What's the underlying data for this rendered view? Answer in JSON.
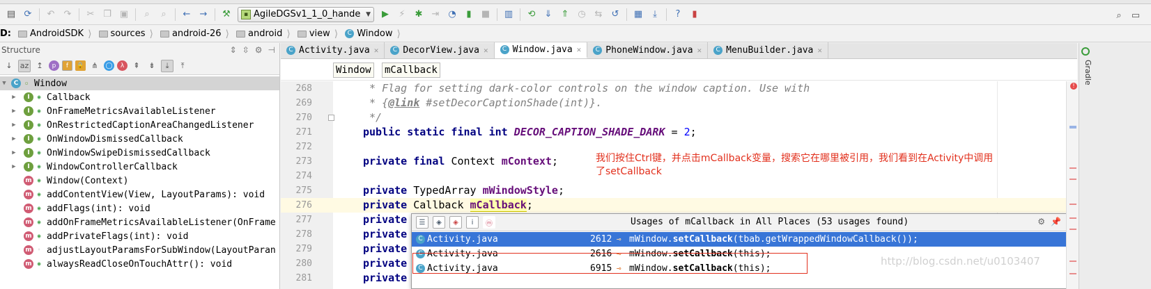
{
  "toolbar": {
    "run_config": "AgileDGSv1_1_0_hande"
  },
  "breadcrumb": {
    "prefix": "D:",
    "items": [
      "AndroidSDK",
      "sources",
      "android-26",
      "android",
      "view",
      "Window"
    ]
  },
  "structure": {
    "title": "Structure",
    "root": "Window",
    "items": [
      {
        "label": "Callback",
        "kind": "interface"
      },
      {
        "label": "OnFrameMetricsAvailableListener",
        "kind": "interface"
      },
      {
        "label": "OnRestrictedCaptionAreaChangedListener",
        "kind": "interface"
      },
      {
        "label": "OnWindowDismissedCallback",
        "kind": "interface"
      },
      {
        "label": "OnWindowSwipeDismissedCallback",
        "kind": "interface"
      },
      {
        "label": "WindowControllerCallback",
        "kind": "interface"
      },
      {
        "label": "Window(Context)",
        "kind": "method"
      },
      {
        "label": "addContentView(View, LayoutParams): void",
        "kind": "method"
      },
      {
        "label": "addFlags(int): void",
        "kind": "method"
      },
      {
        "label": "addOnFrameMetricsAvailableListener(OnFrame",
        "kind": "method"
      },
      {
        "label": "addPrivateFlags(int): void",
        "kind": "method"
      },
      {
        "label": "adjustLayoutParamsForSubWindow(LayoutParan",
        "kind": "method"
      },
      {
        "label": "alwaysReadCloseOnTouchAttr(): void",
        "kind": "method"
      }
    ]
  },
  "tabs": [
    {
      "label": "Activity.java",
      "active": false
    },
    {
      "label": "DecorView.java",
      "active": false
    },
    {
      "label": "Window.java",
      "active": true
    },
    {
      "label": "PhoneWindow.java",
      "active": false
    },
    {
      "label": "MenuBuilder.java",
      "active": false
    }
  ],
  "code_breadcrumb": [
    "Window",
    "mCallback"
  ],
  "code_lines": {
    "268": {
      "num": "268",
      "text": " * Flag for setting dark-color controls on the window caption. Use with"
    },
    "269": {
      "num": "269",
      "pre": " * {",
      "tag": "@link",
      "post": " #setDecorCaptionShade(int)}."
    },
    "270": {
      "num": "270",
      "text": " */"
    },
    "271": {
      "num": "271",
      "kw": "public static final int ",
      "const": "DECOR_CAPTION_SHADE_DARK",
      "eq": " = ",
      "val": "2",
      "end": ";"
    },
    "272": {
      "num": "272"
    },
    "273": {
      "num": "273",
      "kw": "private final ",
      "type": "Context ",
      "field": "mContext",
      "end": ";"
    },
    "274": {
      "num": "274"
    },
    "275": {
      "num": "275",
      "kw": "private ",
      "type": "TypedArray ",
      "field": "mWindowStyle",
      "end": ";"
    },
    "276": {
      "num": "276",
      "kw": "private ",
      "type": "Callback ",
      "field": "mCallback",
      "end": ";"
    },
    "277": {
      "num": "277",
      "kw": "private"
    },
    "278": {
      "num": "278",
      "kw": "private"
    },
    "279": {
      "num": "279",
      "kw": "private"
    },
    "280": {
      "num": "280",
      "kw": "private"
    },
    "281": {
      "num": "281",
      "kw": "private"
    }
  },
  "annotation": "我们按住Ctrl键，并点击mCallback变量，搜索它在哪里被引用，我们看到在Activity中调用了setCallback",
  "usages": {
    "title": "Usages of mCallback in All Places (53 usages found)",
    "rows": [
      {
        "file": "Activity.java",
        "line": "2612",
        "pre": "mWindow.",
        "call": "setCallback",
        "post": "(tbab.getWrappedWindowCallback());",
        "selected": true
      },
      {
        "file": "Activity.java",
        "line": "2616",
        "pre": "mWindow.",
        "call": "setCallback",
        "post": "(this);",
        "selected": false
      },
      {
        "file": "Activity.java",
        "line": "6915",
        "pre": "mWindow.",
        "call": "setCallback",
        "post": "(this);",
        "selected": false
      }
    ]
  },
  "watermark": "http://blog.csdn.net/u0103407",
  "side_panel": {
    "gradle": "Gradle"
  }
}
